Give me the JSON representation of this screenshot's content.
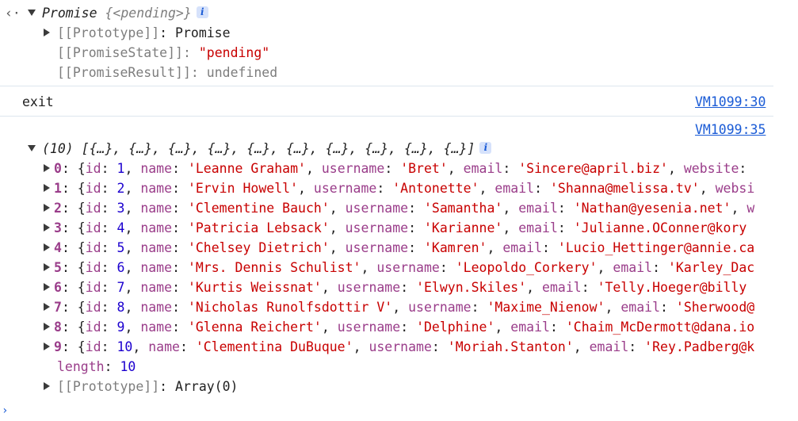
{
  "promise": {
    "header_name": "Promise",
    "header_state": "{<pending>}",
    "proto_key": "[[Prototype]]",
    "proto_val": "Promise",
    "state_key": "[[PromiseState]]",
    "state_val": "\"pending\"",
    "result_key": "[[PromiseResult]]",
    "result_val": "undefined"
  },
  "log_exit": {
    "text": "exit",
    "source": "VM1099:30"
  },
  "array_log": {
    "source": "VM1099:35",
    "summary_count": "(10)",
    "summary_items": "[{…}, {…}, {…}, {…}, {…}, {…}, {…}, {…}, {…}, {…}]",
    "rows": [
      {
        "index": "0",
        "id": "1",
        "name": "'Leanne Graham'",
        "username": "'Bret'",
        "email": "'Sincere@april.biz'",
        "tail": ", website: "
      },
      {
        "index": "1",
        "id": "2",
        "name": "'Ervin Howell'",
        "username": "'Antonette'",
        "email": "'Shanna@melissa.tv'",
        "tail": ", websi"
      },
      {
        "index": "2",
        "id": "3",
        "name": "'Clementine Bauch'",
        "username": "'Samantha'",
        "email": "'Nathan@yesenia.net'",
        "tail": ", w"
      },
      {
        "index": "3",
        "id": "4",
        "name": "'Patricia Lebsack'",
        "username": "'Karianne'",
        "email": "'Julianne.OConner@kory",
        "tail": ""
      },
      {
        "index": "4",
        "id": "5",
        "name": "'Chelsey Dietrich'",
        "username": "'Kamren'",
        "email": "'Lucio_Hettinger@annie.ca",
        "tail": ""
      },
      {
        "index": "5",
        "id": "6",
        "name": "'Mrs. Dennis Schulist'",
        "username": "'Leopoldo_Corkery'",
        "email": "'Karley_Dac",
        "tail": ""
      },
      {
        "index": "6",
        "id": "7",
        "name": "'Kurtis Weissnat'",
        "username": "'Elwyn.Skiles'",
        "email": "'Telly.Hoeger@billy",
        "tail": ""
      },
      {
        "index": "7",
        "id": "8",
        "name": "'Nicholas Runolfsdottir V'",
        "username": "'Maxime_Nienow'",
        "email": "'Sherwood@",
        "tail": ""
      },
      {
        "index": "8",
        "id": "9",
        "name": "'Glenna Reichert'",
        "username": "'Delphine'",
        "email": "'Chaim_McDermott@dana.io",
        "tail": ""
      },
      {
        "index": "9",
        "id": "10",
        "name": "'Clementina DuBuque'",
        "username": "'Moriah.Stanton'",
        "email": "'Rey.Padberg@k",
        "tail": ""
      }
    ],
    "length_key": "length",
    "length_val": "10",
    "proto_key": "[[Prototype]]",
    "proto_val": "Array(0)"
  },
  "labels": {
    "id": "id",
    "name": "name",
    "username": "username",
    "email": "email"
  }
}
